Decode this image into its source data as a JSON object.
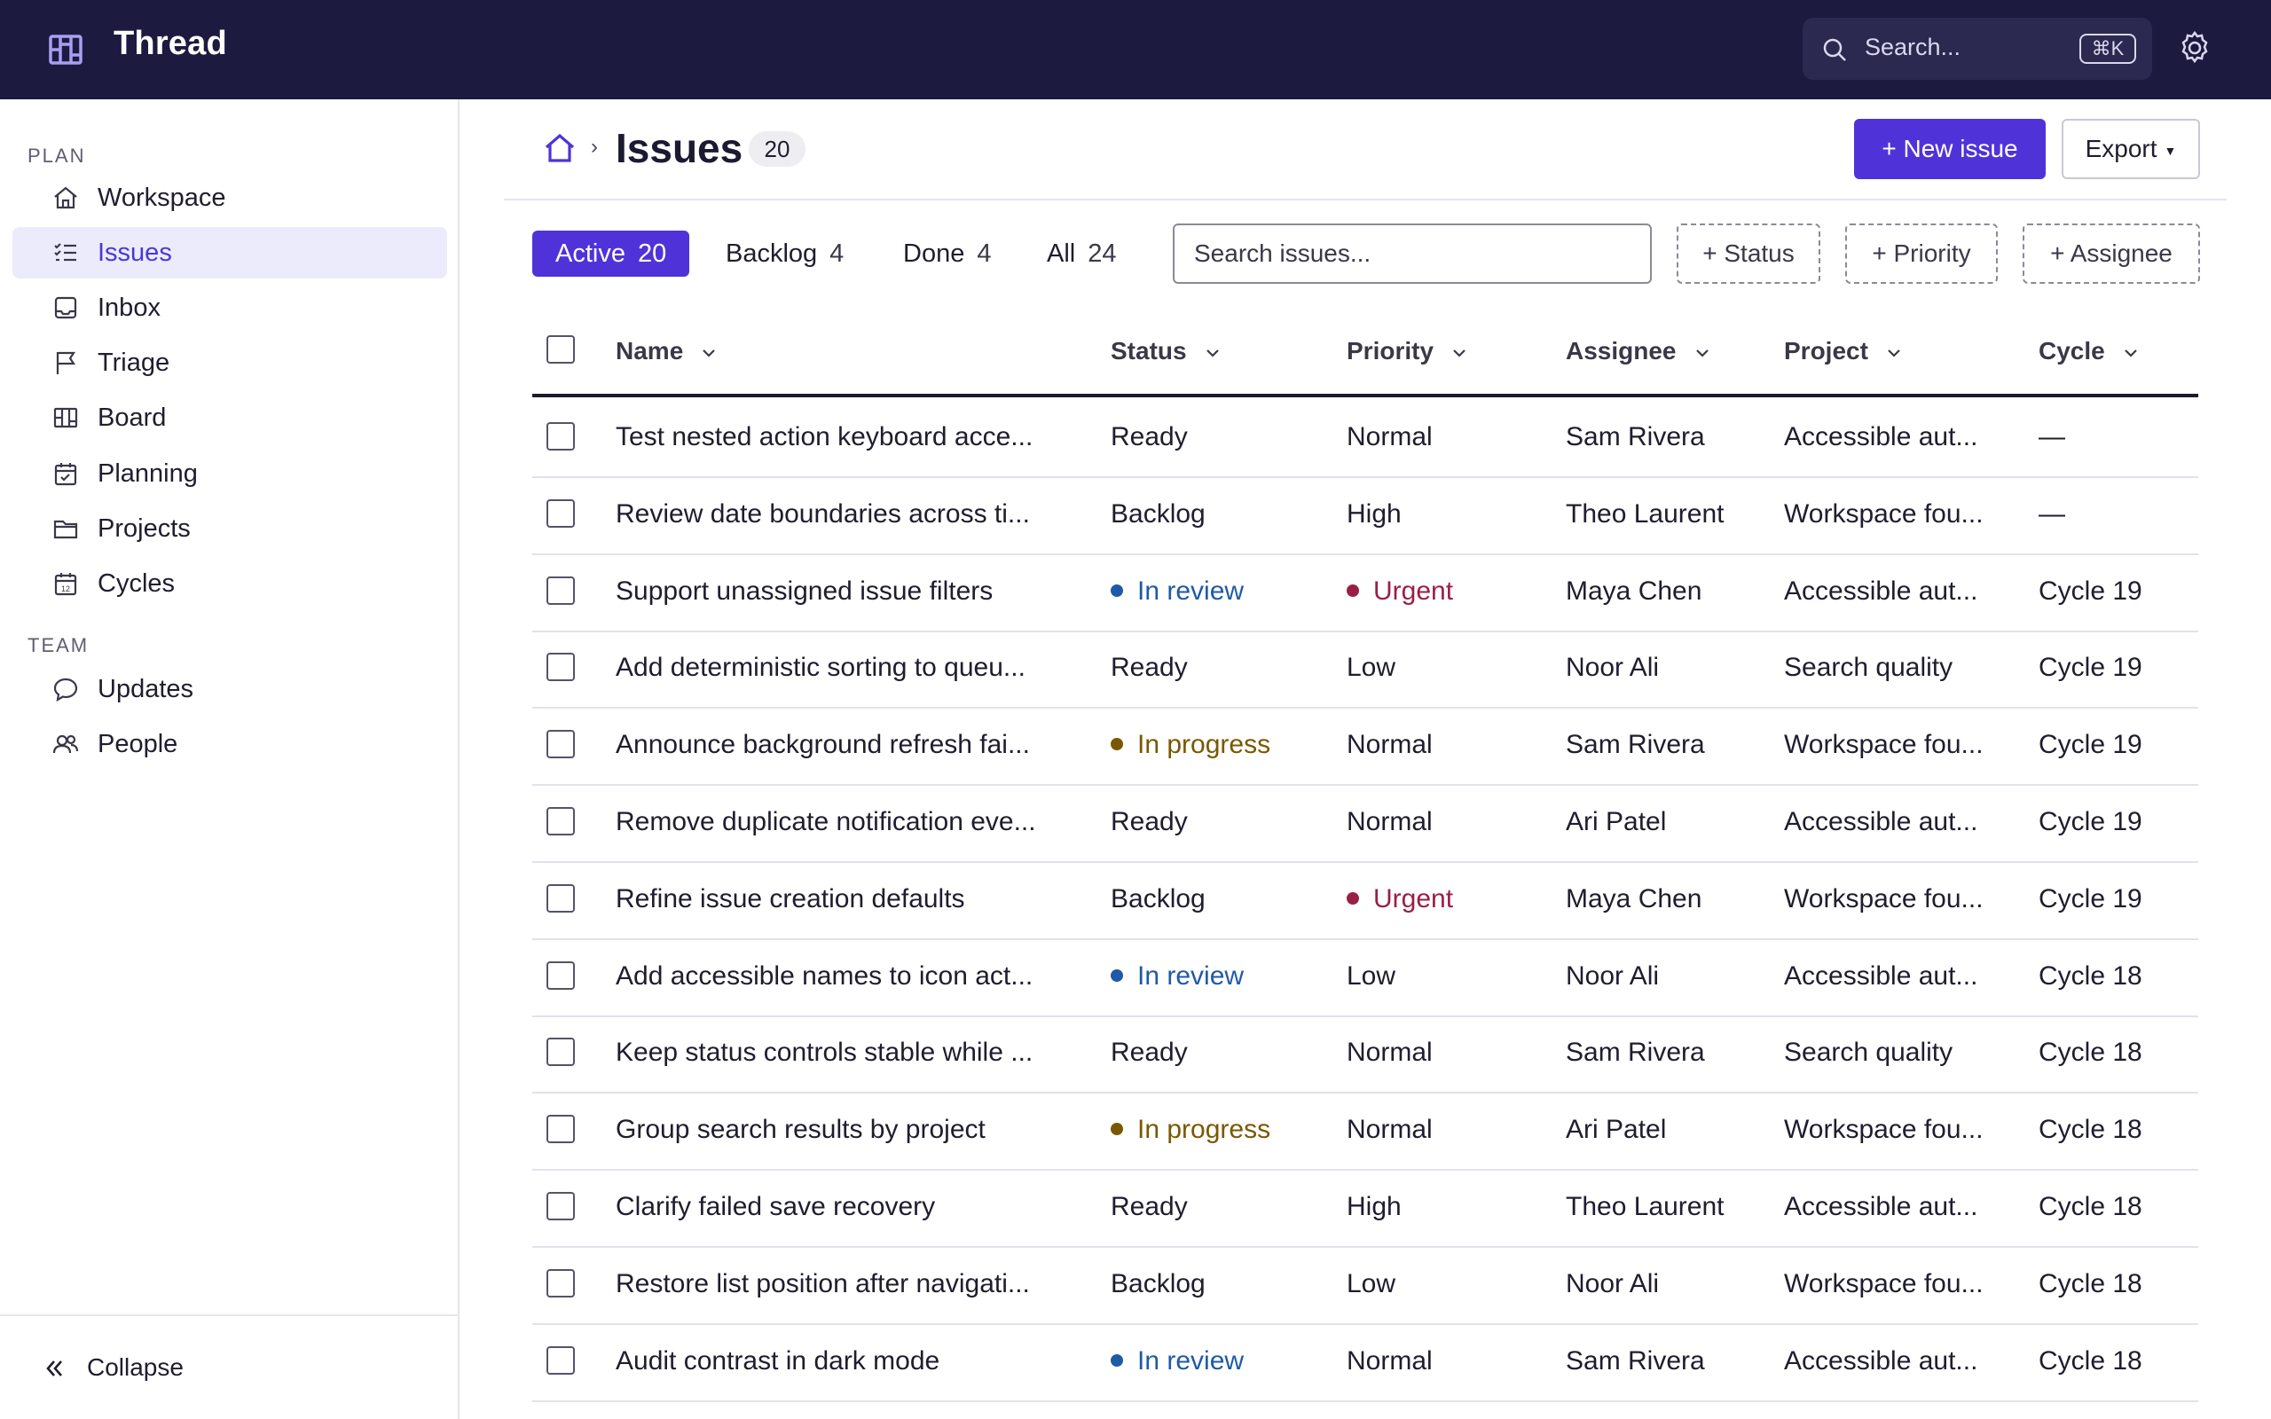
{
  "app": {
    "name": "Thread",
    "search_placeholder": "Search...",
    "search_shortcut": "⌘K",
    "icons": {
      "brand": "board-grid-icon",
      "search": "search-icon",
      "settings": "gear-icon"
    }
  },
  "sidebar": {
    "plan_label": "PLAN",
    "team_label": "TEAM",
    "plan_items": [
      {
        "label": "Workspace",
        "icon": "home-icon"
      },
      {
        "label": "Issues",
        "icon": "checklist-icon",
        "active": true
      },
      {
        "label": "Inbox",
        "icon": "inbox-icon"
      },
      {
        "label": "Triage",
        "icon": "flag-icon"
      },
      {
        "label": "Board",
        "icon": "board-icon"
      },
      {
        "label": "Planning",
        "icon": "calendar-check-icon"
      },
      {
        "label": "Projects",
        "icon": "folder-icon"
      },
      {
        "label": "Cycles",
        "icon": "calendar-icon"
      }
    ],
    "team_items": [
      {
        "label": "Updates",
        "icon": "chat-bubble-icon"
      },
      {
        "label": "People",
        "icon": "people-icon"
      }
    ],
    "collapse_label": "Collapse"
  },
  "header": {
    "breadcrumb_sep": "›",
    "title": "Issues",
    "count": "20",
    "new_issue_label": "+ New issue",
    "export_label": "Export"
  },
  "filters": {
    "tabs": [
      {
        "label": "Active",
        "count": "20",
        "active": true
      },
      {
        "label": "Backlog",
        "count": "4"
      },
      {
        "label": "Done",
        "count": "4"
      },
      {
        "label": "All",
        "count": "24"
      }
    ],
    "search_placeholder": "Search issues...",
    "chips": [
      "+ Status",
      "+ Priority",
      "+ Assignee"
    ]
  },
  "table": {
    "columns": [
      "Name",
      "Status",
      "Priority",
      "Assignee",
      "Project",
      "Cycle"
    ],
    "rows": [
      {
        "name": "Test nested action keyboard acce...",
        "status": "Ready",
        "priority": "Normal",
        "assignee": "Sam Rivera",
        "project": "Accessible aut...",
        "cycle": "—"
      },
      {
        "name": "Review date boundaries across ti...",
        "status": "Backlog",
        "priority": "High",
        "assignee": "Theo Laurent",
        "project": "Workspace fou...",
        "cycle": "—"
      },
      {
        "name": "Support unassigned issue filters",
        "status": "In review",
        "priority": "Urgent",
        "assignee": "Maya Chen",
        "project": "Accessible aut...",
        "cycle": "Cycle 19"
      },
      {
        "name": "Add deterministic sorting to queu...",
        "status": "Ready",
        "priority": "Low",
        "assignee": "Noor Ali",
        "project": "Search quality",
        "cycle": "Cycle 19"
      },
      {
        "name": "Announce background refresh fai...",
        "status": "In progress",
        "priority": "Normal",
        "assignee": "Sam Rivera",
        "project": "Workspace fou...",
        "cycle": "Cycle 19"
      },
      {
        "name": "Remove duplicate notification eve...",
        "status": "Ready",
        "priority": "Normal",
        "assignee": "Ari Patel",
        "project": "Accessible aut...",
        "cycle": "Cycle 19"
      },
      {
        "name": "Refine issue creation defaults",
        "status": "Backlog",
        "priority": "Urgent",
        "assignee": "Maya Chen",
        "project": "Workspace fou...",
        "cycle": "Cycle 19"
      },
      {
        "name": "Add accessible names to icon act...",
        "status": "In review",
        "priority": "Low",
        "assignee": "Noor Ali",
        "project": "Accessible aut...",
        "cycle": "Cycle 18"
      },
      {
        "name": "Keep status controls stable while ...",
        "status": "Ready",
        "priority": "Normal",
        "assignee": "Sam Rivera",
        "project": "Search quality",
        "cycle": "Cycle 18"
      },
      {
        "name": "Group search results by project",
        "status": "In progress",
        "priority": "Normal",
        "assignee": "Ari Patel",
        "project": "Workspace fou...",
        "cycle": "Cycle 18"
      },
      {
        "name": "Clarify failed save recovery",
        "status": "Ready",
        "priority": "High",
        "assignee": "Theo Laurent",
        "project": "Accessible aut...",
        "cycle": "Cycle 18"
      },
      {
        "name": "Restore list position after navigati...",
        "status": "Backlog",
        "priority": "Low",
        "assignee": "Noor Ali",
        "project": "Workspace fou...",
        "cycle": "Cycle 18"
      },
      {
        "name": "Audit contrast in dark mode",
        "status": "In review",
        "priority": "Normal",
        "assignee": "Sam Rivera",
        "project": "Accessible aut...",
        "cycle": "Cycle 18"
      }
    ]
  },
  "colors": {
    "topbar_bg": "#1c1a3f",
    "accent": "#4f33d9",
    "active_nav_bg": "#ecebfb",
    "in_review": "#1f5aa6",
    "in_progress": "#7a5800",
    "urgent": "#9a1f45"
  }
}
